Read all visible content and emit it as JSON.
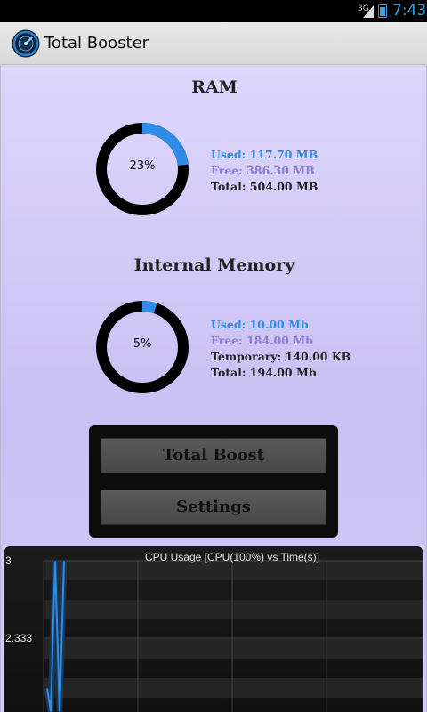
{
  "status_bar": {
    "network": "3G",
    "time": "7:43",
    "accent": "#33b5e5"
  },
  "action_bar": {
    "title": "Total Booster",
    "icon": "booster-gauge-icon"
  },
  "ram": {
    "title": "RAM",
    "percent_label": "23%",
    "used_fraction": 0.2335,
    "used": "Used: 117.70 MB",
    "free": "Free: 386.30 MB",
    "total": "Total: 504.00 MB"
  },
  "internal": {
    "title": "Internal Memory",
    "percent_label": "5%",
    "used_fraction": 0.0515,
    "used": "Used: 10.00 Mb",
    "free": "Free: 184.00 Mb",
    "temporary": "Temporary: 140.00 KB",
    "total": "Total: 194.00 Mb"
  },
  "buttons": {
    "total_boost": "Total Boost",
    "settings": "Settings"
  },
  "colors": {
    "used": "#2e8be6",
    "free": "#8f7ad8",
    "ring": "#000000"
  },
  "chart_data": {
    "type": "line",
    "title": "CPU Usage [CPU(100%) vs Time(s)]",
    "xlabel": "",
    "ylabel": "",
    "y_ticks": [
      "3",
      "2.333"
    ],
    "ylim": [
      1.667,
      3
    ],
    "series": [
      {
        "values": [
          1.9,
          1.7,
          3,
          1.7,
          3
        ]
      }
    ]
  }
}
